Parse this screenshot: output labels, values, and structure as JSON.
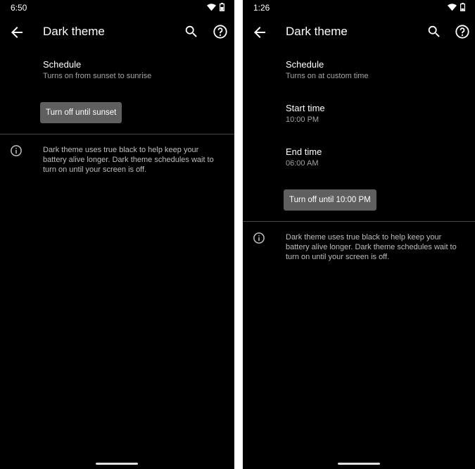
{
  "left": {
    "status_time": "6:50",
    "title": "Dark theme",
    "schedule": {
      "title": "Schedule",
      "summary": "Turns on from sunset to sunrise"
    },
    "action_label": "Turn off until sunset",
    "info": "Dark theme uses true black to help keep your battery alive longer. Dark theme schedules wait to turn on until your screen is off."
  },
  "right": {
    "status_time": "1:26",
    "title": "Dark theme",
    "schedule": {
      "title": "Schedule",
      "summary": "Turns on at custom time"
    },
    "start_time": {
      "title": "Start time",
      "value": "10:00 PM"
    },
    "end_time": {
      "title": "End time",
      "value": "06:00 AM"
    },
    "action_label": "Turn off until 10:00 PM",
    "info": "Dark theme uses true black to help keep your battery alive longer. Dark theme schedules wait to turn on until your screen is off."
  },
  "icons": {
    "back": "arrow-back",
    "search": "search",
    "help": "help-circle",
    "info": "info-circle",
    "wifi": "wifi",
    "battery": "battery"
  },
  "colors": {
    "background": "#000000",
    "button": "#5f5f5f",
    "summary_text": "#a3a3a3"
  }
}
